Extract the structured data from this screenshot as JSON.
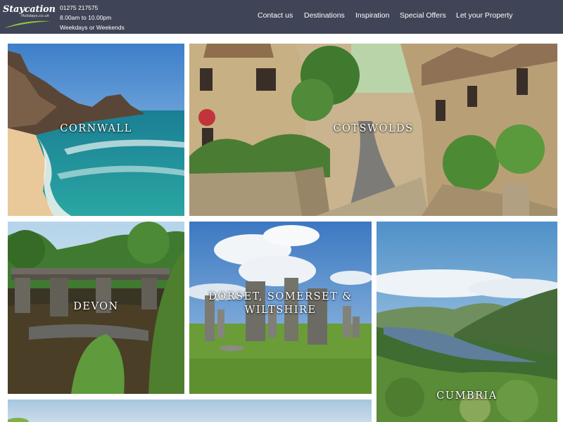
{
  "brand": {
    "logo_text": "Staycation",
    "logo_subtext": "Holidays.co.uk",
    "phone": "01275 217575",
    "hours": "8.00am to 10.00pm",
    "days": "Weekdays or Weekends"
  },
  "nav": {
    "items": [
      {
        "label": "Contact us"
      },
      {
        "label": "Destinations"
      },
      {
        "label": "Inspiration"
      },
      {
        "label": "Special Offers"
      },
      {
        "label": "Let your Property"
      }
    ]
  },
  "destinations": [
    {
      "name": "CORNWALL"
    },
    {
      "name": "COTSWOLDS"
    },
    {
      "name": "DEVON"
    },
    {
      "name": "DORSET, SOMERSET & WILTSHIRE"
    },
    {
      "name": "CUMBRIA"
    }
  ],
  "colors": {
    "header_bg": "#3f4456",
    "logo_swoosh": "#8cc63f"
  }
}
